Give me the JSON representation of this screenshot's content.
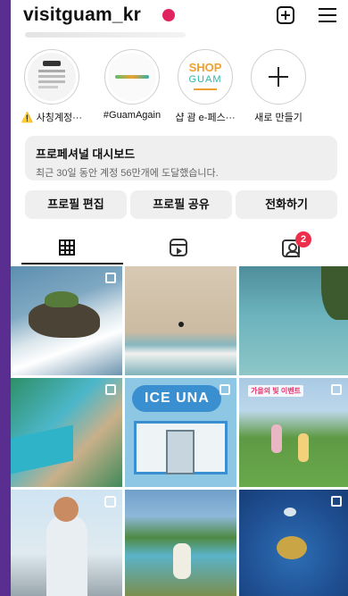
{
  "profile": {
    "username": "visitguam_kr"
  },
  "highlights": [
    {
      "label": "⚠️ 사칭계정···",
      "icon": "notice-thumb"
    },
    {
      "label": "#GuamAgain",
      "icon": "guam-again-thumb"
    },
    {
      "label": "샵 괌 e-페스···",
      "icon": "shop-guam-thumb",
      "logo_text": [
        "SHOP",
        "GUAM"
      ]
    },
    {
      "label": "새로 만들기",
      "icon": "plus-icon"
    }
  ],
  "dashboard": {
    "title": "프로페셔널 대시보드",
    "subtitle": "최근 30일 동안 계정 56만개에 도달했습니다."
  },
  "buttons": {
    "edit": "프로필 편집",
    "share": "프로필 공유",
    "call": "전화하기"
  },
  "tabs": {
    "active": "posts",
    "tagged_badge": "2"
  },
  "photos": {
    "sign": "ICE UNA",
    "event": "가을의 빛 이벤트"
  },
  "colors": {
    "live_dot": "#e0245e",
    "badge": "#ed2f4b",
    "background_frame": "#5a2d91",
    "shop_guam_orange": "#f0a030",
    "shop_guam_teal": "#2fb3a8"
  }
}
